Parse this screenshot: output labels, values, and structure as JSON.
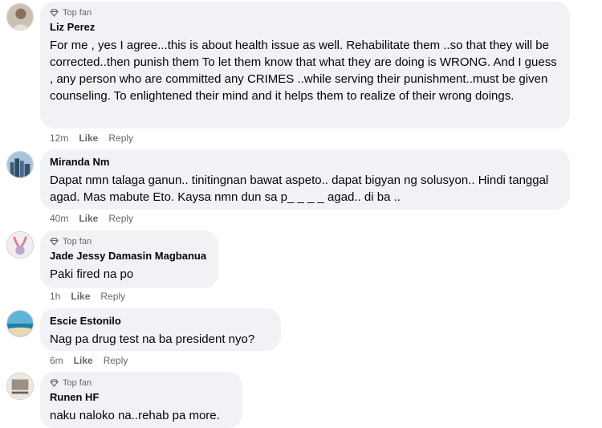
{
  "comments": [
    {
      "badge": "Top fan",
      "author": "Liz Perez",
      "text": "For me , yes I agree...this is about health issue as well. Rehabilitate them ..so that they will be corrected..then punish them To let them know that what they are doing is WRONG. And I guess , any person who are committed any CRIMES ..while serving their punishment..must be given counseling. To enlightened their mind and it helps them to realize of their wrong doings.",
      "time": "12m",
      "like": "Like",
      "reply": "Reply"
    },
    {
      "badge": "",
      "author": "Miranda Nm",
      "text": "Dapat nmn talaga ganun.. tinitingnan bawat aspeto.. dapat bigyan ng solusyon.. Hindi tanggal agad. Mas mabute Eto. Kaysa nmn dun sa p_ _ _ _ agad.. di ba ..",
      "time": "40m",
      "like": "Like",
      "reply": "Reply"
    },
    {
      "badge": "Top fan",
      "author": "Jade Jessy Damasin Magbanua",
      "text": "Paki fired na po",
      "time": "1h",
      "like": "Like",
      "reply": "Reply"
    },
    {
      "badge": "",
      "author": "Escie Estonilo",
      "text": "Nag pa drug test na ba president nyo?",
      "time": "6m",
      "like": "Like",
      "reply": "Reply"
    },
    {
      "badge": "Top fan",
      "author": "Runen HF",
      "text": "naku naloko na..rehab pa more.",
      "time": "",
      "like": "",
      "reply": ""
    }
  ],
  "icons": {
    "badge": "diamond-icon"
  },
  "colors": {
    "bubble": "#f0f2f5",
    "meta": "#65676b",
    "text": "#050505"
  }
}
